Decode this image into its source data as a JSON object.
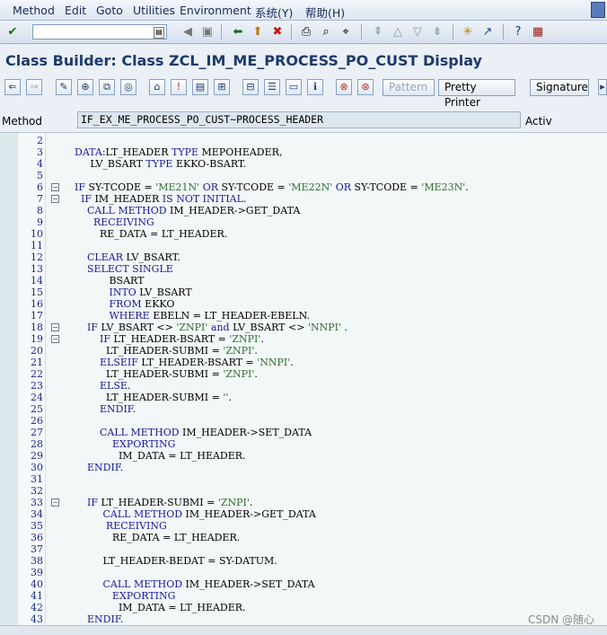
{
  "menu": [
    "Method",
    "Edit",
    "Goto",
    "Utilities",
    "Environment",
    "系统(Y)",
    "帮助(H)"
  ],
  "command_field": "",
  "title": "Class Builder: Class ZCL_IM_ME_PROCESS_PO_CUST Display",
  "app_toolbar": {
    "pattern_label": "Pattern",
    "pretty_printer_label": "Pretty Printer",
    "signature_label": "Signature"
  },
  "method_row": {
    "label": "Method",
    "value": "IF_EX_ME_PROCESS_PO_CUST~PROCESS_HEADER",
    "status": "Activ"
  },
  "code_lines": [
    {
      "n": "2",
      "t": "",
      "fold": false
    },
    {
      "n": "3",
      "t": "DATA:LT_HEADER TYPE MEPOHEADER,",
      "fold": false
    },
    {
      "n": "4",
      "t": "     LV_BSART TYPE EKKO-BSART.",
      "fold": false
    },
    {
      "n": "5",
      "t": "",
      "fold": false
    },
    {
      "n": "6",
      "t": "IF SY-TCODE = 'ME21N' OR SY-TCODE = 'ME22N' OR SY-TCODE = 'ME23N'.",
      "fold": true
    },
    {
      "n": "7",
      "t": "  IF IM_HEADER IS NOT INITIAL.",
      "fold": true
    },
    {
      "n": "8",
      "t": "    CALL METHOD IM_HEADER->GET_DATA",
      "fold": false
    },
    {
      "n": "9",
      "t": "      RECEIVING",
      "fold": false
    },
    {
      "n": "10",
      "t": "        RE_DATA = LT_HEADER.",
      "fold": false
    },
    {
      "n": "11",
      "t": "",
      "fold": false
    },
    {
      "n": "12",
      "t": "    CLEAR LV_BSART.",
      "fold": false
    },
    {
      "n": "13",
      "t": "    SELECT SINGLE",
      "fold": false
    },
    {
      "n": "14",
      "t": "           BSART",
      "fold": false
    },
    {
      "n": "15",
      "t": "           INTO LV_BSART",
      "fold": false
    },
    {
      "n": "16",
      "t": "           FROM EKKO",
      "fold": false
    },
    {
      "n": "17",
      "t": "           WHERE EBELN = LT_HEADER-EBELN.",
      "fold": false
    },
    {
      "n": "18",
      "t": "    IF LV_BSART <> 'ZNPI' and LV_BSART <> 'NNPI' .",
      "fold": true
    },
    {
      "n": "19",
      "t": "        IF LT_HEADER-BSART = 'ZNPI'.",
      "fold": true
    },
    {
      "n": "20",
      "t": "          LT_HEADER-SUBMI = 'ZNPI'.",
      "fold": false
    },
    {
      "n": "21",
      "t": "        ELSEIF LT_HEADER-BSART = 'NNPI'.",
      "fold": false
    },
    {
      "n": "22",
      "t": "          LT_HEADER-SUBMI = 'ZNPI'.",
      "fold": false
    },
    {
      "n": "23",
      "t": "        ELSE.",
      "fold": false
    },
    {
      "n": "24",
      "t": "          LT_HEADER-SUBMI = ''.",
      "fold": false
    },
    {
      "n": "25",
      "t": "        ENDIF.",
      "fold": false
    },
    {
      "n": "26",
      "t": "",
      "fold": false
    },
    {
      "n": "27",
      "t": "        CALL METHOD IM_HEADER->SET_DATA",
      "fold": false
    },
    {
      "n": "28",
      "t": "            EXPORTING",
      "fold": false
    },
    {
      "n": "29",
      "t": "              IM_DATA = LT_HEADER.",
      "fold": false
    },
    {
      "n": "30",
      "t": "    ENDIF.",
      "fold": false
    },
    {
      "n": "31",
      "t": "",
      "fold": false
    },
    {
      "n": "32",
      "t": "",
      "fold": false
    },
    {
      "n": "33",
      "t": "    IF LT_HEADER-SUBMI = 'ZNPI'.",
      "fold": true
    },
    {
      "n": "34",
      "t": "         CALL METHOD IM_HEADER->GET_DATA",
      "fold": false
    },
    {
      "n": "35",
      "t": "          RECEIVING",
      "fold": false
    },
    {
      "n": "36",
      "t": "            RE_DATA = LT_HEADER.",
      "fold": false
    },
    {
      "n": "37",
      "t": "",
      "fold": false
    },
    {
      "n": "38",
      "t": "         LT_HEADER-BEDAT = SY-DATUM.",
      "fold": false
    },
    {
      "n": "39",
      "t": "",
      "fold": false
    },
    {
      "n": "40",
      "t": "         CALL METHOD IM_HEADER->SET_DATA",
      "fold": false
    },
    {
      "n": "41",
      "t": "            EXPORTING",
      "fold": false
    },
    {
      "n": "42",
      "t": "              IM_DATA = LT_HEADER.",
      "fold": false
    },
    {
      "n": "43",
      "t": "    ENDIF.",
      "fold": false
    }
  ],
  "watermark": "CSDN @随心"
}
